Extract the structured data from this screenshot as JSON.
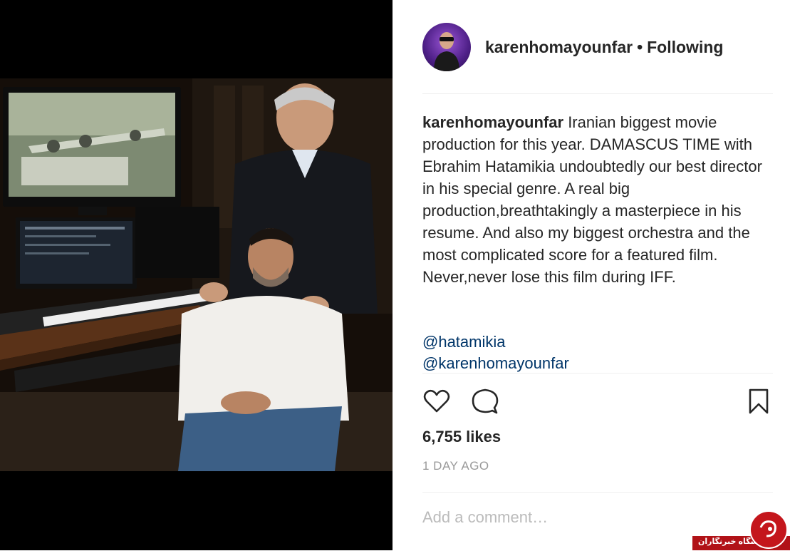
{
  "post": {
    "username": "karenhomayounfar",
    "separator": "•",
    "follow_status": "Following",
    "caption_user": "karenhomayounfar",
    "caption_lines": [
      "Iranian biggest movie production for this year. DAMASCUS TIME with Ebrahim Hatamikia undoubtedly our best director in his special genre. A real big production,breathtakingly a masterpiece in his resume. And also my biggest orchestra and the most complicated score for a featured film.",
      "Never,never lose this film during IFF."
    ],
    "mentions": [
      "@hatamikia",
      "@karenhomayounfar"
    ],
    "likes": "6,755 likes",
    "time_ago": "1 DAY AGO",
    "comment_placeholder": "Add a comment…"
  },
  "icons": {
    "like": "heart-icon",
    "comment": "speech-bubble-icon",
    "save": "bookmark-icon"
  },
  "watermark": {
    "text": "باشگاه خبرنگاران"
  },
  "colors": {
    "text": "#262626",
    "link": "#003569",
    "muted": "#999999",
    "divider": "#efefef",
    "watermark_red": "#c4161c"
  }
}
